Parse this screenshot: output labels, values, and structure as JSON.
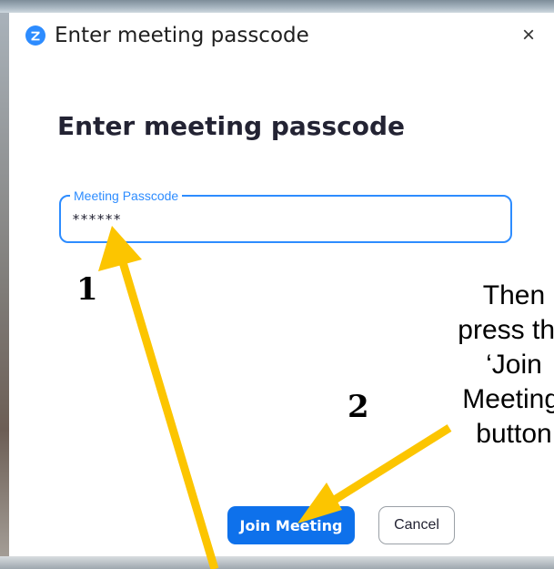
{
  "window": {
    "title": "Enter meeting passcode",
    "close_label": "×"
  },
  "dialog": {
    "heading": "Enter meeting passcode",
    "passcode_field": {
      "label": "Meeting Passcode",
      "value": "******"
    },
    "buttons": {
      "join": "Join Meeting",
      "cancel": "Cancel"
    }
  },
  "annotations": {
    "step1_number": "1",
    "step2_number": "2",
    "instruction_text": "Then\npress the\n‘Join\nMeeting’\nbutton"
  },
  "colors": {
    "accent": "#0e71eb",
    "field_border": "#2d8cff",
    "arrow": "#fcc500",
    "logo": "#2d8cff"
  },
  "icons": {
    "app": "zoom-logo-icon",
    "close": "close-icon",
    "arrow1": "arrow-annotation-icon",
    "arrow2": "arrow-annotation-icon"
  }
}
